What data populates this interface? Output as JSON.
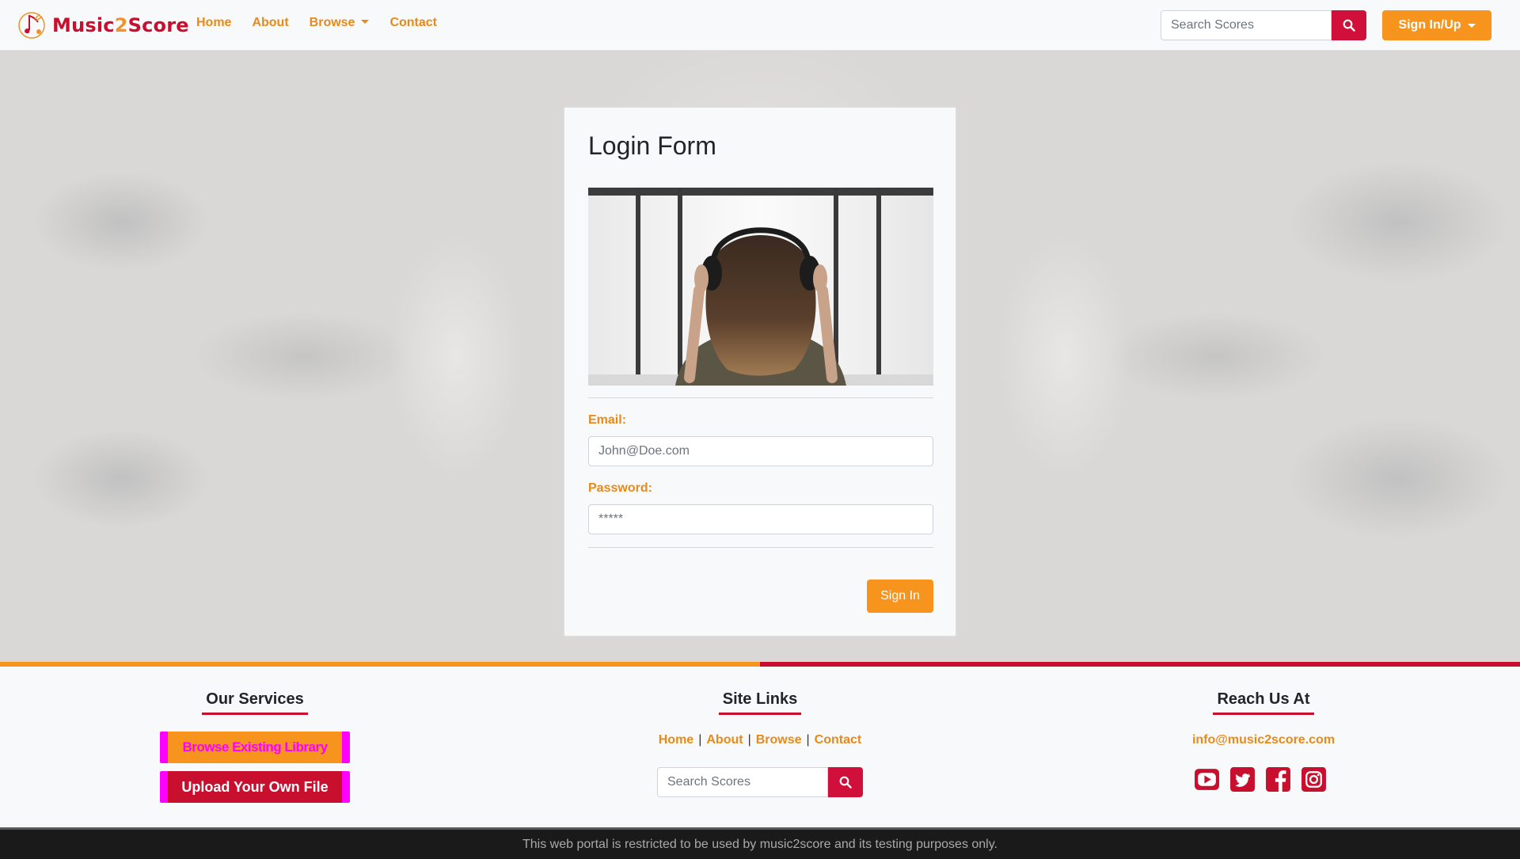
{
  "navbar": {
    "brand": {
      "prefix": "Music",
      "two": "2",
      "suffix": "Score"
    },
    "links": [
      {
        "label": "Home"
      },
      {
        "label": "About"
      },
      {
        "label": "Browse"
      },
      {
        "label": "Contact"
      }
    ],
    "search_placeholder": "Search Scores",
    "signin_label": "Sign In/Up"
  },
  "login": {
    "title": "Login Form",
    "email_label": "Email:",
    "email_placeholder": "John@Doe.com",
    "password_label": "Password:",
    "password_placeholder": "*****",
    "submit_label": "Sign In"
  },
  "footer": {
    "services": {
      "title": "Our Services",
      "browse_label": "Browse Existing Library",
      "upload_label": "Upload Your Own File"
    },
    "site_links": {
      "title": "Site Links",
      "links": [
        "Home",
        "About",
        "Browse",
        "Contact"
      ],
      "separator": "|",
      "search_placeholder": "Search Scores"
    },
    "reach": {
      "title": "Reach Us At",
      "email": "info@music2score.com",
      "social_icons": [
        "youtube-icon",
        "twitter-icon",
        "facebook-icon",
        "instagram-icon"
      ]
    },
    "disclaimer": "This web portal is restricted to be used by music2score and its testing purposes only."
  },
  "colors": {
    "accent_orange": "#f7941d",
    "accent_red": "#c8102e",
    "magenta": "#ff00ff"
  }
}
